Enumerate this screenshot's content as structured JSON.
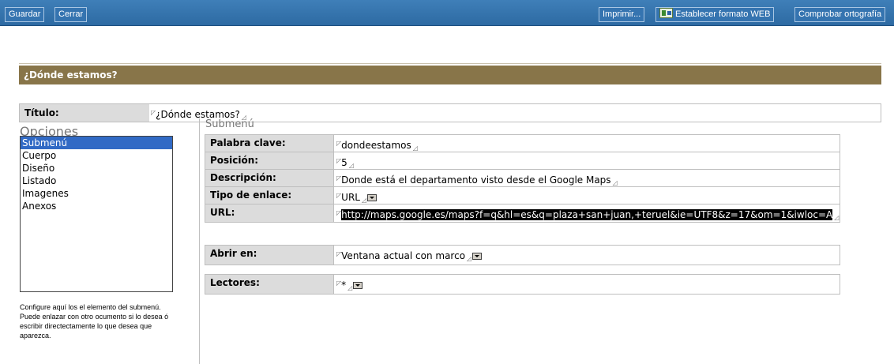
{
  "toolbar": {
    "save_label": "Guardar",
    "close_label": "Cerrar",
    "print_label": "Imprimir...",
    "web_format_label": "Establecer formato WEB",
    "spellcheck_label": "Comprobar ortografía"
  },
  "header": {
    "title": "¿Dónde estamos?"
  },
  "title_field": {
    "label": "Título:",
    "value": "¿Dónde estamos?"
  },
  "options": {
    "heading": "Opciones",
    "items": [
      "Submenú",
      "Cuerpo",
      "Diseño",
      "Listado",
      "Imagenes",
      "Anexos"
    ],
    "selected": "Submenú",
    "help": "Configure aquí los el elemento del submenú. Puede enlazar con otro ocumento si lo desea ó escribir directectamente lo que desea que aparezca."
  },
  "submenu": {
    "heading": "Submenú",
    "keyword": {
      "label": "Palabra clave:",
      "value": "dondeestamos"
    },
    "position": {
      "label": "Posición:",
      "value": "5"
    },
    "description": {
      "label": "Descripción:",
      "value": "Donde está el departamento visto desde el Google Maps"
    },
    "link_type": {
      "label": "Tipo de enlace:",
      "value": "URL"
    },
    "url": {
      "label": "URL:",
      "value": "http://maps.google.es/maps?f=q&hl=es&q=plaza+san+juan,+teruel&ie=UTF8&z=17&om=1&iwloc=A"
    },
    "open_in": {
      "label": "Abrir en:",
      "value": "Ventana actual con marco"
    },
    "readers": {
      "label": "Lectores:",
      "value": "*"
    }
  },
  "icons": {
    "field_start": "field-start-marker-icon",
    "field_end": "field-end-marker-icon",
    "dropdown": "dropdown-arrow-icon",
    "web_format": "web-format-icon"
  },
  "colors": {
    "toolbar": "#3574b0",
    "header_bar": "#887549",
    "label_bg": "#dcdcdc",
    "selection": "#316ac5"
  }
}
